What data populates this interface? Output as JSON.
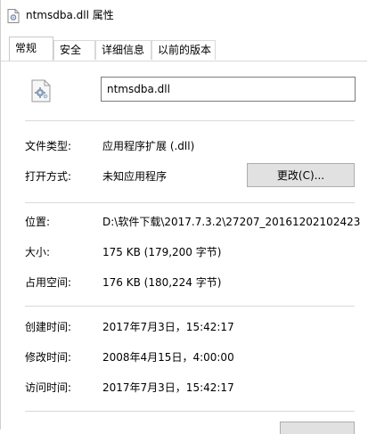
{
  "window": {
    "title": "ntmsdba.dll 属性"
  },
  "tabs": [
    {
      "label": "常规",
      "active": true
    },
    {
      "label": "安全",
      "active": false
    },
    {
      "label": "详细信息",
      "active": false
    },
    {
      "label": "以前的版本",
      "active": false
    }
  ],
  "general": {
    "filename": "ntmsdba.dll",
    "file_type_label": "文件类型:",
    "file_type_value": "应用程序扩展 (.dll)",
    "opens_with_label": "打开方式:",
    "opens_with_value": "未知应用程序",
    "change_button": "更改(C)...",
    "location_label": "位置:",
    "location_value": "D:\\软件下载\\2017.7.3.2\\27207_20161202102423",
    "size_label": "大小:",
    "size_value": "175 KB (179,200 字节)",
    "size_on_disk_label": "占用空间:",
    "size_on_disk_value": "176 KB (180,224 字节)",
    "created_label": "创建时间:",
    "created_value": "2017年7月3日，15:42:17",
    "modified_label": "修改时间:",
    "modified_value": "2008年4月15日，4:00:00",
    "accessed_label": "访问时间:",
    "accessed_value": "2017年7月3日，15:42:17"
  },
  "icons": {
    "app_icon": "dll-file-icon",
    "file_icon": "gear-file-icon"
  },
  "colors": {
    "button_bg": "#e1e1e1",
    "button_border": "#adadad",
    "separator": "#d9d9d9"
  }
}
